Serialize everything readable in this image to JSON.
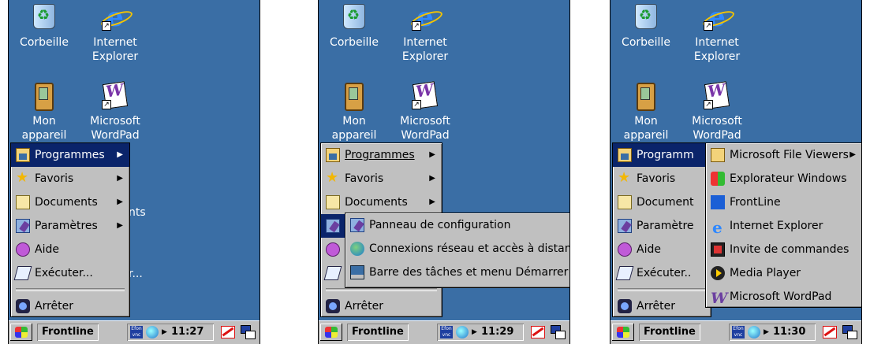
{
  "desktop": {
    "recycle_bin": "Corbeille",
    "ie": "Internet\nExplorer",
    "my_device": "Mon\nappareil",
    "wordpad": "Microsoft\nWordPad"
  },
  "start_menu": {
    "programs": "Programmes",
    "favorites": "Favoris",
    "documents": "Documents",
    "settings": "Paramètres",
    "help": "Aide",
    "run": "Exécuter...",
    "shutdown": "Arrêter",
    "programs_cut": "Programm",
    "documents_cut": "Document",
    "settings_cut": "Paramètre",
    "run_cut": "Exécuter.."
  },
  "settings_submenu": {
    "items": [
      "Panneau de configuration",
      "Connexions réseau et accès à distan",
      "Barre des tâches et menu Démarrer"
    ]
  },
  "programs_submenu": {
    "items": [
      "Microsoft File Viewers",
      "Explorateur Windows",
      "FrontLine",
      "Internet Explorer",
      "Invite de commandes",
      "Media Player",
      "Microsoft WordPad"
    ]
  },
  "stray_text": {
    "a": "nts",
    "b": "r..."
  },
  "taskbar": {
    "task": "Frontline",
    "vnc": "Efon\nvnc",
    "clocks": [
      "11:27",
      "11:29",
      "11:30"
    ]
  }
}
